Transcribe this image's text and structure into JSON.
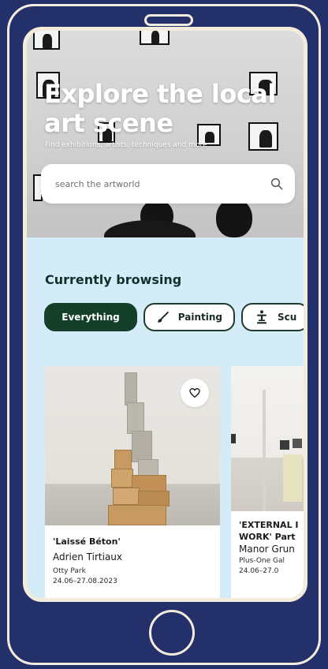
{
  "hero": {
    "title": "Explore the local art scene",
    "subtitle": "Find exhibitions, artists, techniques and more"
  },
  "search": {
    "placeholder": "search the artworld",
    "icon": "search-icon"
  },
  "browsing": {
    "title": "Currently browsing",
    "chips": [
      {
        "label": "Everything",
        "active": true
      },
      {
        "label": "Painting",
        "icon": "paintbrush-icon",
        "active": false
      },
      {
        "label": "Scu",
        "icon": "sculpture-icon",
        "active": false
      }
    ]
  },
  "cards": [
    {
      "title": "'Laissé Béton'",
      "artist": "Adrien Tirtiaux",
      "venue": "Otty Park",
      "dates": "24.06–27.08.2023",
      "favorite_icon": "heart-icon"
    },
    {
      "title_line1": "'EXTERNAL I",
      "title_line2": "WORK' Part",
      "artist": "Manor Grun",
      "venue": "Plus-One Gal",
      "dates": "24.06–27.0"
    }
  ],
  "colors": {
    "background": "#24306a",
    "frame": "#f3ecdd",
    "screen_bg": "#d3ecf8",
    "chip_active": "#14402a",
    "heading": "#14302a"
  }
}
